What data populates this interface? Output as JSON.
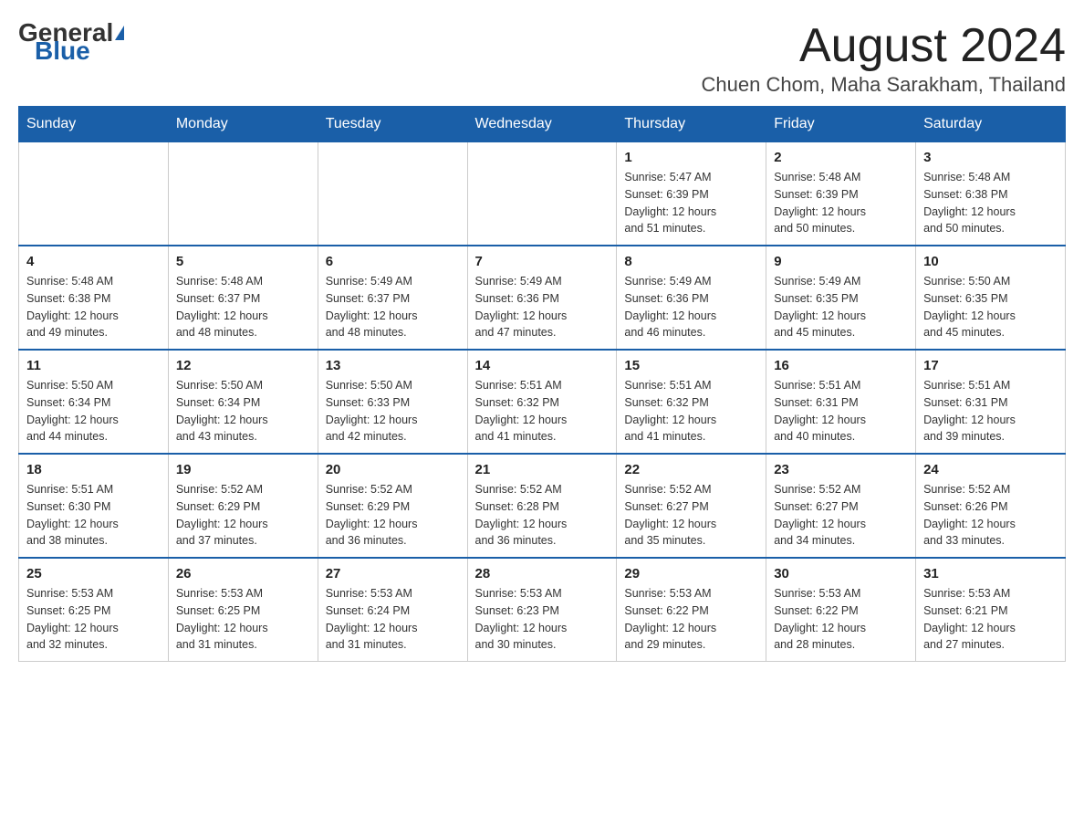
{
  "header": {
    "logo_general": "General",
    "logo_blue": "Blue",
    "month_title": "August 2024",
    "location": "Chuen Chom, Maha Sarakham, Thailand"
  },
  "weekdays": [
    "Sunday",
    "Monday",
    "Tuesday",
    "Wednesday",
    "Thursday",
    "Friday",
    "Saturday"
  ],
  "weeks": [
    [
      {
        "day": "",
        "info": ""
      },
      {
        "day": "",
        "info": ""
      },
      {
        "day": "",
        "info": ""
      },
      {
        "day": "",
        "info": ""
      },
      {
        "day": "1",
        "info": "Sunrise: 5:47 AM\nSunset: 6:39 PM\nDaylight: 12 hours\nand 51 minutes."
      },
      {
        "day": "2",
        "info": "Sunrise: 5:48 AM\nSunset: 6:39 PM\nDaylight: 12 hours\nand 50 minutes."
      },
      {
        "day": "3",
        "info": "Sunrise: 5:48 AM\nSunset: 6:38 PM\nDaylight: 12 hours\nand 50 minutes."
      }
    ],
    [
      {
        "day": "4",
        "info": "Sunrise: 5:48 AM\nSunset: 6:38 PM\nDaylight: 12 hours\nand 49 minutes."
      },
      {
        "day": "5",
        "info": "Sunrise: 5:48 AM\nSunset: 6:37 PM\nDaylight: 12 hours\nand 48 minutes."
      },
      {
        "day": "6",
        "info": "Sunrise: 5:49 AM\nSunset: 6:37 PM\nDaylight: 12 hours\nand 48 minutes."
      },
      {
        "day": "7",
        "info": "Sunrise: 5:49 AM\nSunset: 6:36 PM\nDaylight: 12 hours\nand 47 minutes."
      },
      {
        "day": "8",
        "info": "Sunrise: 5:49 AM\nSunset: 6:36 PM\nDaylight: 12 hours\nand 46 minutes."
      },
      {
        "day": "9",
        "info": "Sunrise: 5:49 AM\nSunset: 6:35 PM\nDaylight: 12 hours\nand 45 minutes."
      },
      {
        "day": "10",
        "info": "Sunrise: 5:50 AM\nSunset: 6:35 PM\nDaylight: 12 hours\nand 45 minutes."
      }
    ],
    [
      {
        "day": "11",
        "info": "Sunrise: 5:50 AM\nSunset: 6:34 PM\nDaylight: 12 hours\nand 44 minutes."
      },
      {
        "day": "12",
        "info": "Sunrise: 5:50 AM\nSunset: 6:34 PM\nDaylight: 12 hours\nand 43 minutes."
      },
      {
        "day": "13",
        "info": "Sunrise: 5:50 AM\nSunset: 6:33 PM\nDaylight: 12 hours\nand 42 minutes."
      },
      {
        "day": "14",
        "info": "Sunrise: 5:51 AM\nSunset: 6:32 PM\nDaylight: 12 hours\nand 41 minutes."
      },
      {
        "day": "15",
        "info": "Sunrise: 5:51 AM\nSunset: 6:32 PM\nDaylight: 12 hours\nand 41 minutes."
      },
      {
        "day": "16",
        "info": "Sunrise: 5:51 AM\nSunset: 6:31 PM\nDaylight: 12 hours\nand 40 minutes."
      },
      {
        "day": "17",
        "info": "Sunrise: 5:51 AM\nSunset: 6:31 PM\nDaylight: 12 hours\nand 39 minutes."
      }
    ],
    [
      {
        "day": "18",
        "info": "Sunrise: 5:51 AM\nSunset: 6:30 PM\nDaylight: 12 hours\nand 38 minutes."
      },
      {
        "day": "19",
        "info": "Sunrise: 5:52 AM\nSunset: 6:29 PM\nDaylight: 12 hours\nand 37 minutes."
      },
      {
        "day": "20",
        "info": "Sunrise: 5:52 AM\nSunset: 6:29 PM\nDaylight: 12 hours\nand 36 minutes."
      },
      {
        "day": "21",
        "info": "Sunrise: 5:52 AM\nSunset: 6:28 PM\nDaylight: 12 hours\nand 36 minutes."
      },
      {
        "day": "22",
        "info": "Sunrise: 5:52 AM\nSunset: 6:27 PM\nDaylight: 12 hours\nand 35 minutes."
      },
      {
        "day": "23",
        "info": "Sunrise: 5:52 AM\nSunset: 6:27 PM\nDaylight: 12 hours\nand 34 minutes."
      },
      {
        "day": "24",
        "info": "Sunrise: 5:52 AM\nSunset: 6:26 PM\nDaylight: 12 hours\nand 33 minutes."
      }
    ],
    [
      {
        "day": "25",
        "info": "Sunrise: 5:53 AM\nSunset: 6:25 PM\nDaylight: 12 hours\nand 32 minutes."
      },
      {
        "day": "26",
        "info": "Sunrise: 5:53 AM\nSunset: 6:25 PM\nDaylight: 12 hours\nand 31 minutes."
      },
      {
        "day": "27",
        "info": "Sunrise: 5:53 AM\nSunset: 6:24 PM\nDaylight: 12 hours\nand 31 minutes."
      },
      {
        "day": "28",
        "info": "Sunrise: 5:53 AM\nSunset: 6:23 PM\nDaylight: 12 hours\nand 30 minutes."
      },
      {
        "day": "29",
        "info": "Sunrise: 5:53 AM\nSunset: 6:22 PM\nDaylight: 12 hours\nand 29 minutes."
      },
      {
        "day": "30",
        "info": "Sunrise: 5:53 AM\nSunset: 6:22 PM\nDaylight: 12 hours\nand 28 minutes."
      },
      {
        "day": "31",
        "info": "Sunrise: 5:53 AM\nSunset: 6:21 PM\nDaylight: 12 hours\nand 27 minutes."
      }
    ]
  ]
}
